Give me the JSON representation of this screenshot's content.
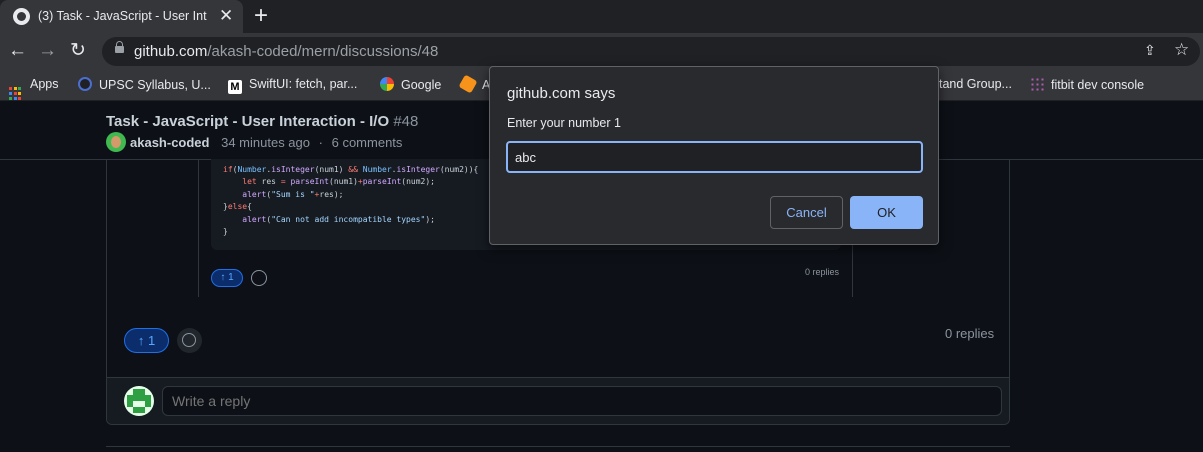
{
  "browser": {
    "tab_title": "(3) Task - JavaScript - User Int",
    "tab_close": "✕",
    "new_tab": "+",
    "url_host": "github.com",
    "url_path": "/akash-coded/mern/discussions/48",
    "bookmarks": [
      {
        "label": "Apps"
      },
      {
        "label": "UPSC Syllabus, U..."
      },
      {
        "label": "SwiftUI: fetch, par..."
      },
      {
        "label": "Google"
      },
      {
        "label": "A"
      },
      {
        "label": "tand Group..."
      },
      {
        "label": "fitbit dev console"
      }
    ]
  },
  "discussion": {
    "title": "Task - JavaScript - User Interaction - I/O",
    "number": "#48",
    "author": "akash-coded",
    "time": "34 minutes ago",
    "sep": "·",
    "comments": "6 comments"
  },
  "code_lines": [
    "if(Number.isInteger(num1) && Number.isInteger(num2)){",
    "    let res = parseInt(num1)+parseInt(num2);",
    "    alert(\"Sum is \"+res);",
    "}else{",
    "    alert(\"Can not add incompatible types\");",
    "}"
  ],
  "nested_reply": {
    "upvotes": "1",
    "replies": "0 replies"
  },
  "comment": {
    "upvotes": "1",
    "replies": "0 replies",
    "reply_placeholder": "Write a reply"
  },
  "dialog": {
    "title": "github.com says",
    "message": "Enter your number 1",
    "input_value": "abc",
    "cancel_label": "Cancel",
    "ok_label": "OK"
  },
  "colors": {
    "accent": "#8ab4f8",
    "github_blue": "#58a6ff",
    "bg": "#0d1117"
  }
}
